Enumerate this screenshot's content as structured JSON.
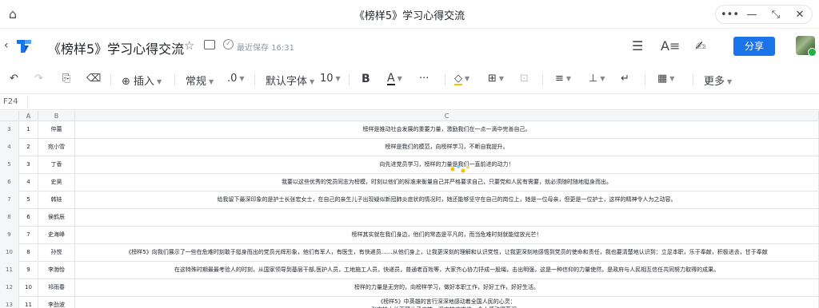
{
  "window": {
    "title": "《榜样5》学习心得交流"
  },
  "doc": {
    "title": "《榜样5》学习心得交流",
    "saved_status": "最近保存 16:31",
    "share_label": "分享"
  },
  "toolbar": {
    "insert_label": "插入",
    "format_label": "常规",
    "decimal_label": ".0",
    "font_label": "默认字体",
    "size_label": "10",
    "bold_label": "B",
    "color_label": "A",
    "more_label": "更多",
    "accent_color": "#1a73e8",
    "text_color_bar": "#1f2329",
    "fill_color_bar": "#f5c400"
  },
  "formula_bar": {
    "cell_ref": "F24"
  },
  "grid": {
    "columns": [
      "A",
      "B",
      "C"
    ],
    "rows": [
      {
        "row": "3",
        "a": "1",
        "b": "仲蕾",
        "c": "榜样是推动社会发展的重要力量，激励我们在一点一滴中完善自己。"
      },
      {
        "row": "4",
        "a": "2",
        "b": "宛小雪",
        "c": "榜样是我们的模范，向榜样学习，不断自我提升。"
      },
      {
        "row": "5",
        "a": "3",
        "b": "丁香",
        "c": "向先进党员学习，榜样的力量是我们一直前进的动力！"
      },
      {
        "row": "6",
        "a": "4",
        "b": "史昊",
        "c": "我要以这些优秀的党员同志为榜模，时刻以他们的标准来衡量自己并严格要求自己，只要党和人民有需要，就必须随时随地挺身而出。"
      },
      {
        "row": "7",
        "a": "5",
        "b": "韩娃",
        "c": "给我留下最深印象的是护士长张宏女士，在自己的亲生儿子出现疑似新冠肺炎症状的情况时，她还能够坚守在自己的岗位上，她是一位母亲，但更是一位护士，这样的精神令人为之动容。"
      },
      {
        "row": "8",
        "a": "6",
        "b": "侯鹤辰",
        "c": ""
      },
      {
        "row": "9",
        "a": "7",
        "b": "史海峰",
        "c": "榜样其实就在我们身边，他们的常态是平凡的，而当危难时刻就能绽放光芒！"
      },
      {
        "row": "10",
        "a": "8",
        "b": "孙悦",
        "c": "《榜样5》向我们展示了一些在危难时刻敢于挺身而出的党员光辉形象，他们有军人，有医生，有快递员……从他们身上，让我更深刻的理解和认识党性，让我更深刻地感悟到党员的使命和责任，我也要清楚地认识到：立足本职，乐于奉献，积极进去，甘于奉献"
      },
      {
        "row": "11",
        "a": "9",
        "b": "李渤怡",
        "c": "在这特殊时期最最考验人的时刻，从国家领导到基层干部,医护人员，工地施工人员，快递员，普通老百姓等，大家齐心协力抒成一股绳，击出明强，这是一种信仰的力量使然，是政府与人民相互信任共同努力取得的成果。"
      },
      {
        "row": "12",
        "a": "10",
        "b": "祁雨春",
        "c": "榜样的力量是无穷的，向榜样学习，做好本职工作，好好工作，好好生活。"
      },
      {
        "row": "13",
        "a": "11",
        "b": "李劲波",
        "c": "《榜样5》中英雄的言行深深地感动着全国人民的心灵：",
        "c2": "张宏护士长不顾儿子病魄，坚守抗疫岗位，令人感动得落泪。"
      }
    ]
  }
}
